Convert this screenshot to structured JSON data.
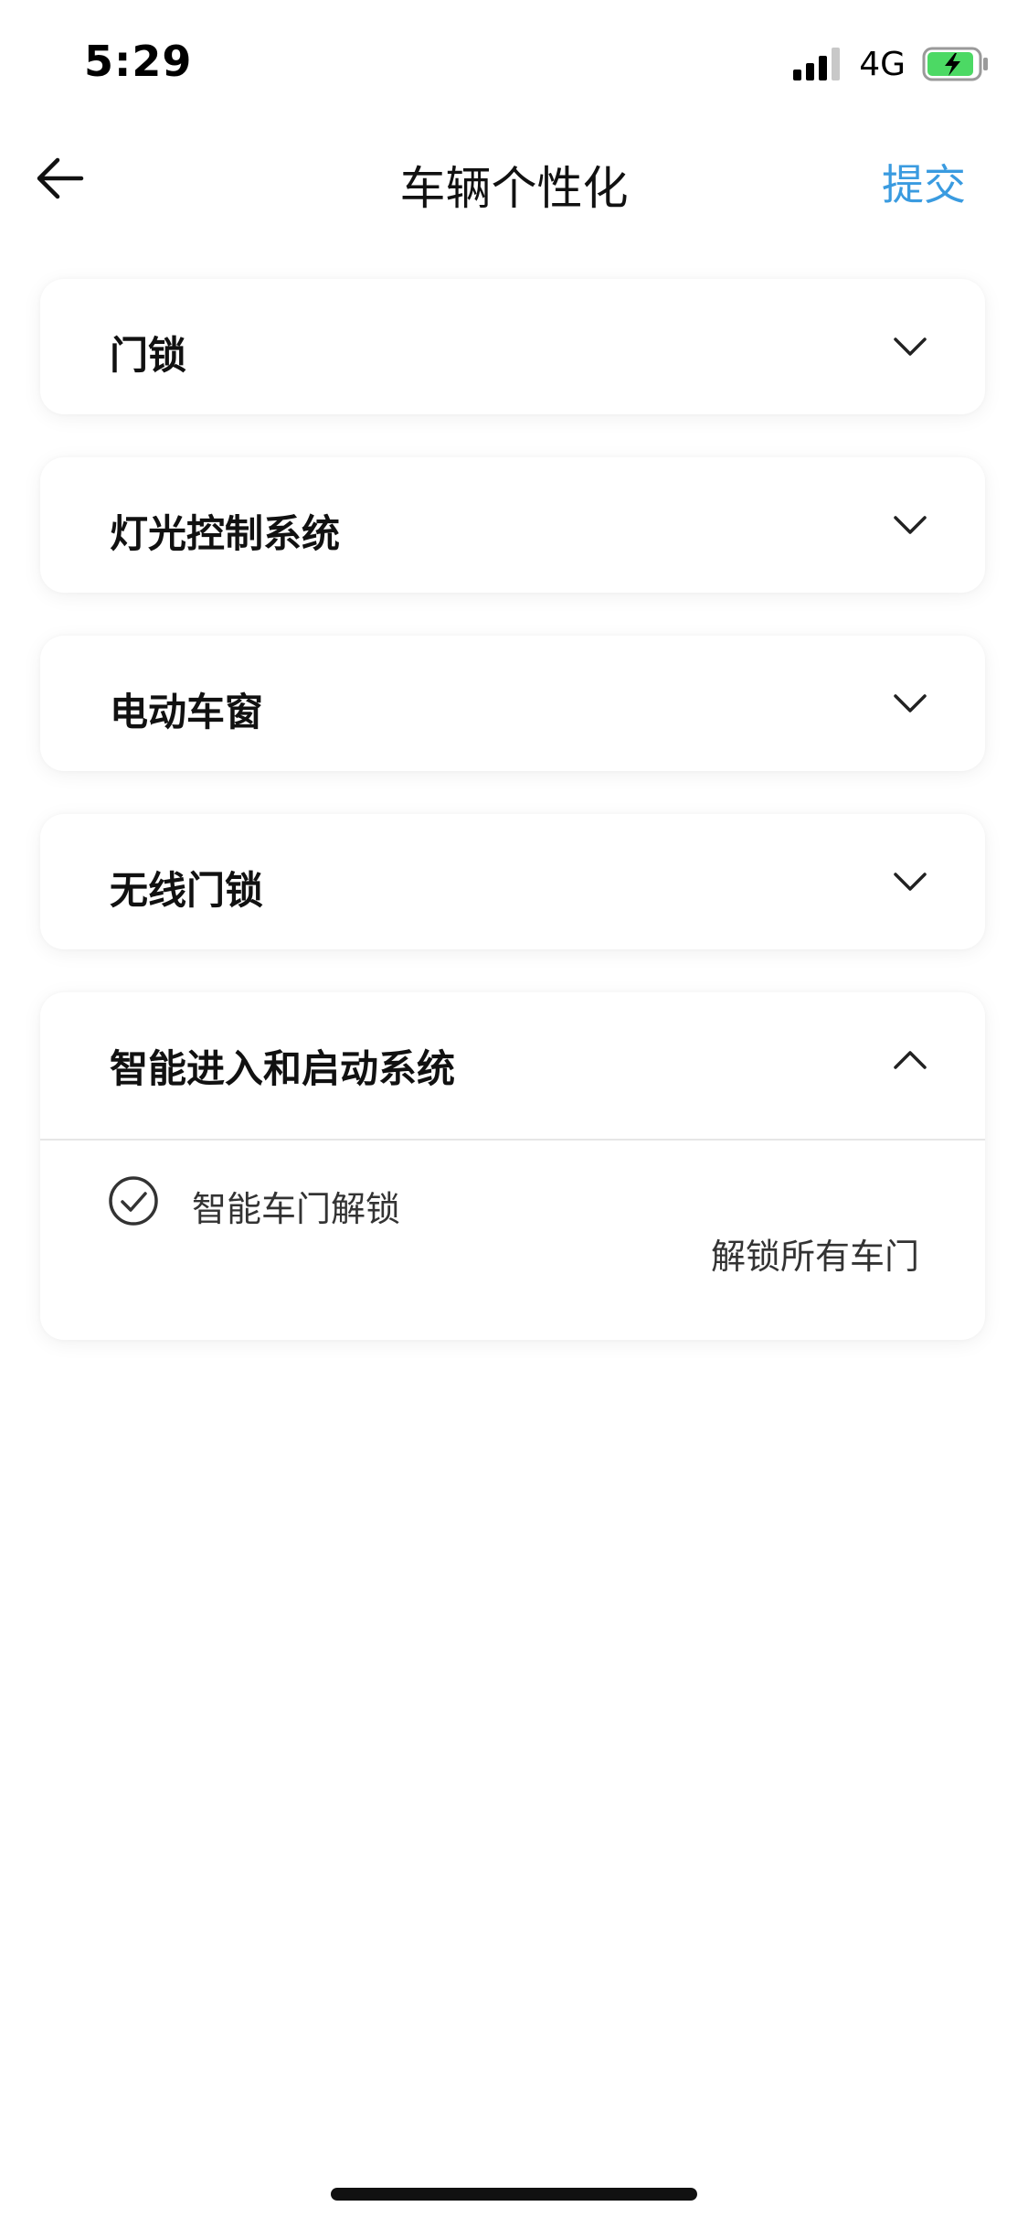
{
  "status_bar": {
    "time": "5:29",
    "network": "4G",
    "battery_color": "#4cd964",
    "signal_icon": "cellular-signal-icon",
    "battery_icon": "battery-charging-icon"
  },
  "nav": {
    "title": "车辆个性化",
    "submit_label": "提交",
    "accent_color": "#3a9be0",
    "back_icon": "arrow-left-icon"
  },
  "sections": [
    {
      "title": "门锁",
      "expanded": false
    },
    {
      "title": "灯光控制系统",
      "expanded": false
    },
    {
      "title": "电动车窗",
      "expanded": false
    },
    {
      "title": "无线门锁",
      "expanded": false
    },
    {
      "title": "智能进入和启动系统",
      "expanded": true,
      "options": [
        {
          "label": "智能车门解锁",
          "value": "解锁所有车门",
          "checked": true
        }
      ]
    }
  ]
}
